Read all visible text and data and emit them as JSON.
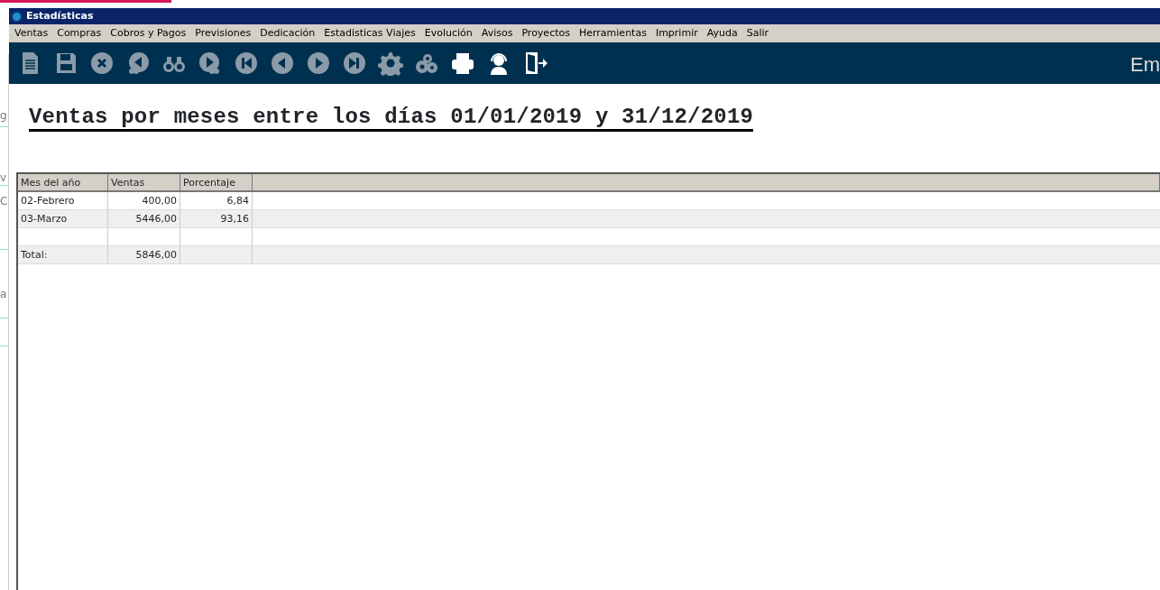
{
  "background_window": {
    "fragments": [
      "g",
      "v",
      "C",
      "a"
    ]
  },
  "window": {
    "title": "Estadísticas"
  },
  "menu": [
    "Ventas",
    "Compras",
    "Cobros y Pagos",
    "Previsiones",
    "Dedicación",
    "Estadisticas Viajes",
    "Evolución",
    "Avisos",
    "Proyectos",
    "Herramientas",
    "Imprimir",
    "Ayuda",
    "Salir"
  ],
  "toolbar": {
    "buttons": [
      {
        "kind": "document",
        "disabled": true
      },
      {
        "kind": "save",
        "disabled": true
      },
      {
        "kind": "close",
        "disabled": true
      },
      {
        "kind": "find-previous",
        "disabled": true
      },
      {
        "kind": "binoculars",
        "disabled": true
      },
      {
        "kind": "find-next",
        "disabled": true
      },
      {
        "kind": "first",
        "disabled": true
      },
      {
        "kind": "previous",
        "disabled": true
      },
      {
        "kind": "next",
        "disabled": true
      },
      {
        "kind": "last",
        "disabled": true
      },
      {
        "kind": "gear",
        "disabled": true
      },
      {
        "kind": "gears",
        "disabled": true
      },
      {
        "kind": "printer",
        "disabled": false
      },
      {
        "kind": "headset",
        "disabled": false
      },
      {
        "kind": "exit",
        "disabled": false
      }
    ],
    "right_text": "Em"
  },
  "report": {
    "title": "Ventas por meses entre los días 01/01/2019 y 31/12/2019"
  },
  "table": {
    "columns": [
      "Mes del año",
      "Ventas",
      "Porcentaje"
    ],
    "rows": [
      {
        "cells": [
          "02-Febrero",
          "400,00",
          "6,84"
        ]
      },
      {
        "cells": [
          "03-Marzo",
          "5446,00",
          "93,16"
        ]
      },
      {
        "cells": []
      },
      {
        "cells": [
          "Total:",
          "5846,00",
          ""
        ]
      }
    ]
  }
}
